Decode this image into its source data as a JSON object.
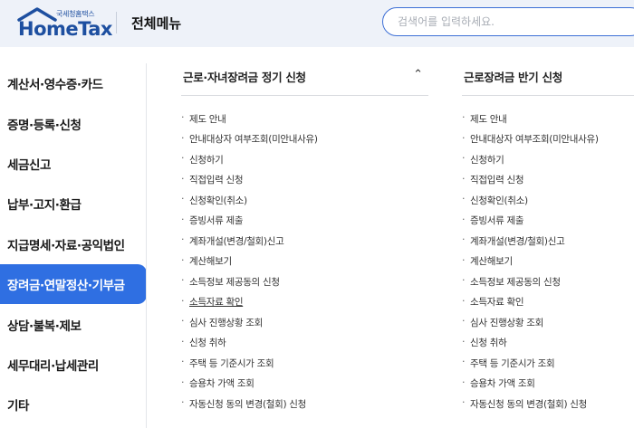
{
  "header": {
    "logo_sub": "국세청홈택스",
    "logo_main": "HomeTax",
    "title": "전체메뉴",
    "search_placeholder": "검색어를 입력하세요.",
    "brand_color": "#1d4fa0",
    "accent_color": "#2f6fe2"
  },
  "sidebar": {
    "items": [
      {
        "label": "계산서·영수증·카드"
      },
      {
        "label": "증명·등록·신청"
      },
      {
        "label": "세금신고"
      },
      {
        "label": "납부·고지·환급"
      },
      {
        "label": "지급명세·자료·공익법인"
      },
      {
        "label": "장려금·연말정산·기부금",
        "active": true
      },
      {
        "label": "상담·불복·제보"
      },
      {
        "label": "세무대리·납세관리"
      },
      {
        "label": "기타"
      }
    ]
  },
  "columns": [
    {
      "title": "근로·자녀장려금 정기 신청",
      "chevron_icon": "chevron-up-icon",
      "links": [
        "제도 안내",
        "안내대상자 여부조회(미안내사유)",
        "신청하기",
        "직접입력 신청",
        "신청확인(취소)",
        "증빙서류 제출",
        "계좌개설(변경/철회)신고",
        "계산해보기",
        "소득정보 제공동의 신청",
        "소득자료 확인",
        "심사 진행상황 조회",
        "신청 취하",
        "주택 등 기준시가 조회",
        "승용차 가액 조회",
        "자동신청 동의 변경(철회) 신청"
      ]
    },
    {
      "title": "근로장려금 반기 신청",
      "links": [
        "제도 안내",
        "안내대상자 여부조회(미안내사유)",
        "신청하기",
        "직접입력 신청",
        "신청확인(취소)",
        "증빙서류 제출",
        "계좌개설(변경/철회)신고",
        "계산해보기",
        "소득정보 제공동의 신청",
        "소득자료 확인",
        "심사 진행상황 조회",
        "신청 취하",
        "주택 등 기준시가 조회",
        "승용차 가액 조회",
        "자동신청 동의 변경(철회) 신청"
      ]
    }
  ]
}
